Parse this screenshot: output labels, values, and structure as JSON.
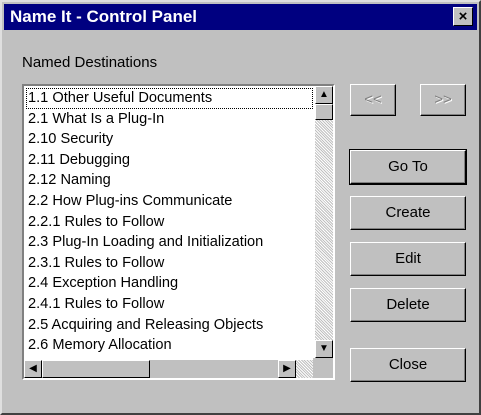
{
  "window": {
    "title": "Name It - Control Panel",
    "close_label": "×"
  },
  "list": {
    "label": "Named Destinations",
    "items": [
      "1.1 Other Useful Documents",
      "2.1 What Is a Plug-In",
      "2.10 Security",
      "2.11 Debugging",
      "2.12 Naming",
      "2.2 How Plug-ins Communicate",
      "2.2.1 Rules to Follow",
      "2.3 Plug-In Loading and Initialization",
      "2.3.1 Rules to Follow",
      "2.4 Exception Handling",
      "2.4.1 Rules to Follow",
      "2.5 Acquiring and Releasing Objects",
      "2.6 Memory Allocation"
    ],
    "focused_index": 0
  },
  "buttons": {
    "prev_label": "<<",
    "next_label": ">>",
    "goto_label": "Go To",
    "create_label": "Create",
    "edit_label": "Edit",
    "delete_label": "Delete",
    "close_label": "Close"
  },
  "icons": {
    "scroll_up": "triangle-up-icon",
    "scroll_down": "triangle-down-icon",
    "scroll_left": "triangle-left-icon",
    "scroll_right": "triangle-right-icon"
  },
  "colors": {
    "titlebar": "#000080",
    "face": "#c0c0c0"
  }
}
